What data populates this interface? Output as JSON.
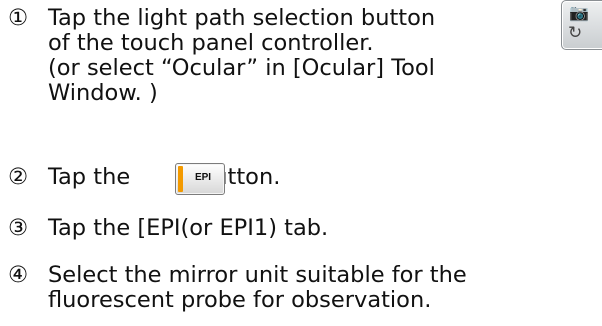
{
  "steps": [
    {
      "number": "①",
      "lines": [
        "Tap the light path selection button",
        "of the touch panel controller.",
        "(or select “Ocular” in [Ocular] Tool",
        "Window. )"
      ]
    },
    {
      "number": "②",
      "before": "Tap the",
      "after": "button."
    },
    {
      "number": "③",
      "text": "Tap the [EPI(or EPI1) tab."
    },
    {
      "number": "④",
      "lines": [
        "Select the mirror unit suitable for the",
        "fluorescent probe for observation."
      ]
    }
  ],
  "light_path_button": {
    "icon_top": "camera-icon",
    "icon_bottom": "rotate-icon",
    "glyph_top": "📷",
    "glyph_bottom": "↻"
  },
  "epi_button": {
    "label": "EPI",
    "accent_color": "#f39a00"
  }
}
